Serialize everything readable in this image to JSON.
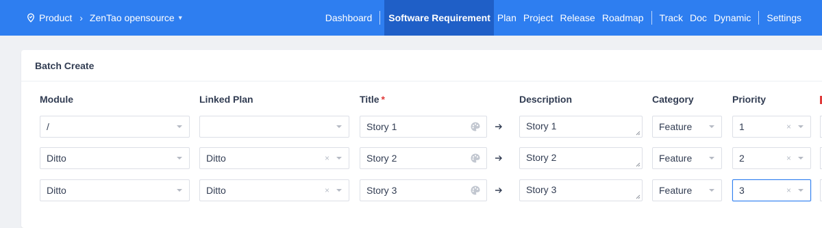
{
  "breadcrumb": {
    "product_label": "Product",
    "project_label": "ZenTao opensource"
  },
  "nav": {
    "items": [
      "Dashboard",
      "Software Requirement",
      "Plan",
      "Project",
      "Release",
      "Roadmap",
      "Track",
      "Doc",
      "Dynamic",
      "Settings"
    ],
    "active": "Software Requirement"
  },
  "panel": {
    "title": "Batch Create"
  },
  "columns": {
    "module": "Module",
    "linked_plan": "Linked Plan",
    "title": "Title",
    "title_required_mark": "*",
    "description": "Description",
    "category": "Category",
    "priority": "Priority"
  },
  "rows": [
    {
      "module": "/",
      "linked_plan": "",
      "title": "Story 1",
      "description": "Story 1",
      "category": "Feature",
      "priority": "1"
    },
    {
      "module": "Ditto",
      "linked_plan": "Ditto",
      "title": "Story 2",
      "description": "Story 2",
      "category": "Feature",
      "priority": "2"
    },
    {
      "module": "Ditto",
      "linked_plan": "Ditto",
      "title": "Story 3",
      "description": "Story 3",
      "category": "Feature",
      "priority": "3"
    }
  ],
  "icons": {
    "clear": "×",
    "arrow": "arrow-right-icon",
    "palette": "palette-icon"
  },
  "colors": {
    "nav_bg": "#2e7ef0",
    "nav_active": "#1f5fc7",
    "required": "#e03a3a",
    "focus": "#2e7ef0"
  }
}
